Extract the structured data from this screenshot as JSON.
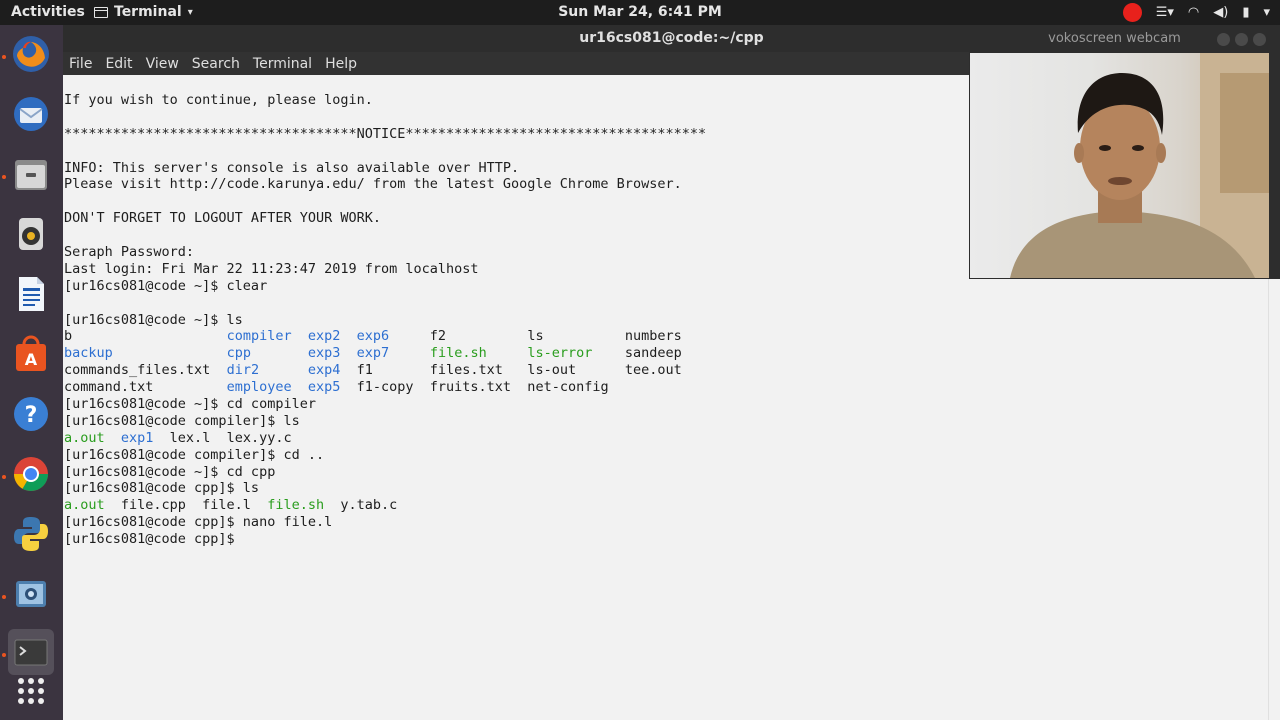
{
  "topbar": {
    "activities": "Activities",
    "app_name": "Terminal",
    "clock": "Sun Mar 24,  6:41 PM"
  },
  "dock": {
    "items": [
      {
        "name": "firefox-icon"
      },
      {
        "name": "thunderbird-icon"
      },
      {
        "name": "files-icon"
      },
      {
        "name": "rhythmbox-icon"
      },
      {
        "name": "writer-icon"
      },
      {
        "name": "software-center-icon"
      },
      {
        "name": "help-icon"
      },
      {
        "name": "chrome-icon"
      },
      {
        "name": "python-icon"
      },
      {
        "name": "screenshot-tool-icon"
      },
      {
        "name": "terminal-icon"
      },
      {
        "name": "show-applications-icon"
      }
    ]
  },
  "terminal": {
    "title": "ur16cs081@code:~/cpp",
    "menu": [
      "File",
      "Edit",
      "View",
      "Search",
      "Terminal",
      "Help"
    ],
    "lines": [
      [
        {
          "t": "If you wish to continue, please login."
        }
      ],
      [
        {
          "t": ""
        }
      ],
      [
        {
          "t": "************************************NOTICE*************************************"
        }
      ],
      [
        {
          "t": ""
        }
      ],
      [
        {
          "t": "INFO: This server's console is also available over HTTP."
        }
      ],
      [
        {
          "t": "Please visit http://code.karunya.edu/ from the latest Google Chrome Browser."
        }
      ],
      [
        {
          "t": ""
        }
      ],
      [
        {
          "t": "DON'T FORGET TO LOGOUT AFTER YOUR WORK."
        }
      ],
      [
        {
          "t": ""
        }
      ],
      [
        {
          "t": "Seraph Password:"
        }
      ],
      [
        {
          "t": "Last login: Fri Mar 22 11:23:47 2019 from localhost"
        }
      ],
      [
        {
          "t": "[ur16cs081@code ~]$ clear"
        }
      ],
      [
        {
          "t": ""
        }
      ],
      [
        {
          "t": "[ur16cs081@code ~]$ ls"
        }
      ],
      [
        {
          "t": "b                   "
        },
        {
          "t": "compiler",
          "c": "dir"
        },
        {
          "t": "  "
        },
        {
          "t": "exp2",
          "c": "dir"
        },
        {
          "t": "  "
        },
        {
          "t": "exp6",
          "c": "dir"
        },
        {
          "t": "     f2          ls          numbers"
        }
      ],
      [
        {
          "t": "backup",
          "c": "dir"
        },
        {
          "t": "              "
        },
        {
          "t": "cpp",
          "c": "dir"
        },
        {
          "t": "       "
        },
        {
          "t": "exp3",
          "c": "dir"
        },
        {
          "t": "  "
        },
        {
          "t": "exp7",
          "c": "dir"
        },
        {
          "t": "     "
        },
        {
          "t": "file.sh",
          "c": "exe"
        },
        {
          "t": "     "
        },
        {
          "t": "ls-error",
          "c": "exe"
        },
        {
          "t": "    sandeep"
        }
      ],
      [
        {
          "t": "commands_files.txt  "
        },
        {
          "t": "dir2",
          "c": "dir"
        },
        {
          "t": "      "
        },
        {
          "t": "exp4",
          "c": "dir"
        },
        {
          "t": "  f1       files.txt   ls-out      tee.out"
        }
      ],
      [
        {
          "t": "command.txt         "
        },
        {
          "t": "employee",
          "c": "dir"
        },
        {
          "t": "  "
        },
        {
          "t": "exp5",
          "c": "dir"
        },
        {
          "t": "  f1-copy  fruits.txt  net-config"
        }
      ],
      [
        {
          "t": "[ur16cs081@code ~]$ cd compiler"
        }
      ],
      [
        {
          "t": "[ur16cs081@code compiler]$ ls"
        }
      ],
      [
        {
          "t": "a.out",
          "c": "exe"
        },
        {
          "t": "  "
        },
        {
          "t": "exp1",
          "c": "dir"
        },
        {
          "t": "  lex.l  lex.yy.c"
        }
      ],
      [
        {
          "t": "[ur16cs081@code compiler]$ cd .."
        }
      ],
      [
        {
          "t": "[ur16cs081@code ~]$ cd cpp"
        }
      ],
      [
        {
          "t": "[ur16cs081@code cpp]$ ls"
        }
      ],
      [
        {
          "t": "a.out",
          "c": "exe"
        },
        {
          "t": "  file.cpp  file.l  "
        },
        {
          "t": "file.sh",
          "c": "exe"
        },
        {
          "t": "  y.tab.c"
        }
      ],
      [
        {
          "t": "[ur16cs081@code cpp]$ nano file.l"
        }
      ],
      [
        {
          "t": "[ur16cs081@code cpp]$ "
        }
      ]
    ]
  },
  "webcam": {
    "title": "vokoscreen webcam"
  },
  "colors": {
    "dir": "#2d6fd1",
    "exe": "#2a9d1e",
    "accent": "#e95420"
  }
}
